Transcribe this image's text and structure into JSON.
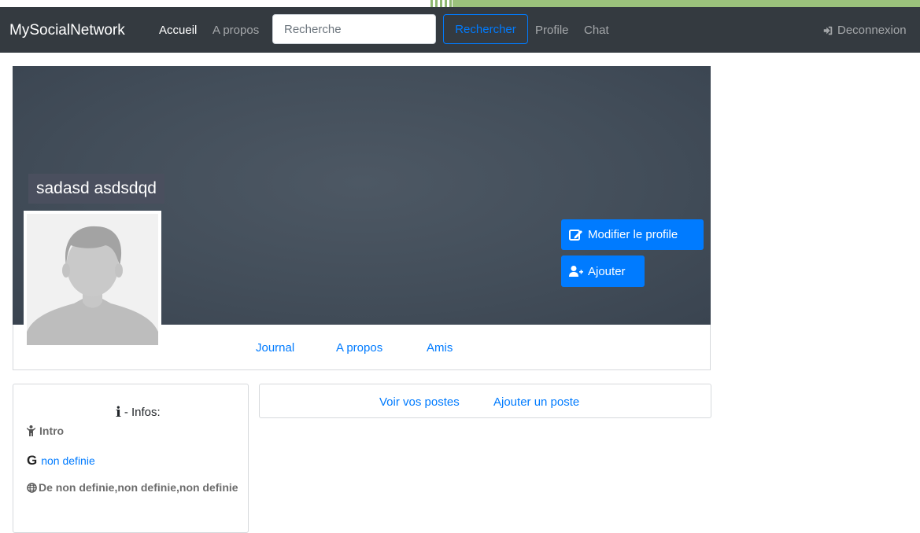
{
  "navbar": {
    "brand": "MySocialNetwork",
    "links": [
      "Accueil",
      "A propos"
    ],
    "search_placeholder": "Recherche",
    "search_button": "Rechercher",
    "links_right": [
      "Profile",
      "Chat"
    ],
    "logout": "Deconnexion"
  },
  "profile": {
    "name": "sadasd asdsdqd",
    "edit_button": "Modifier le profile",
    "add_button": "Ajouter",
    "tabs": [
      "Journal",
      "A propos",
      "Amis"
    ]
  },
  "infos": {
    "title": "- Infos:",
    "intro": "Intro",
    "gender_value": "non definie",
    "location": "De non definie,non definie,non definie"
  },
  "posts": {
    "links": [
      "Voir vos postes",
      "Ajouter un poste"
    ]
  },
  "colors": {
    "navbar": "#343a40",
    "primary": "#007bff",
    "cover": "#434e5a",
    "strip_green": "#9bc27c"
  },
  "icons": [
    "edit-icon",
    "user-plus-icon",
    "logout-icon",
    "info-icon",
    "child-icon",
    "google-icon",
    "globe-icon"
  ]
}
